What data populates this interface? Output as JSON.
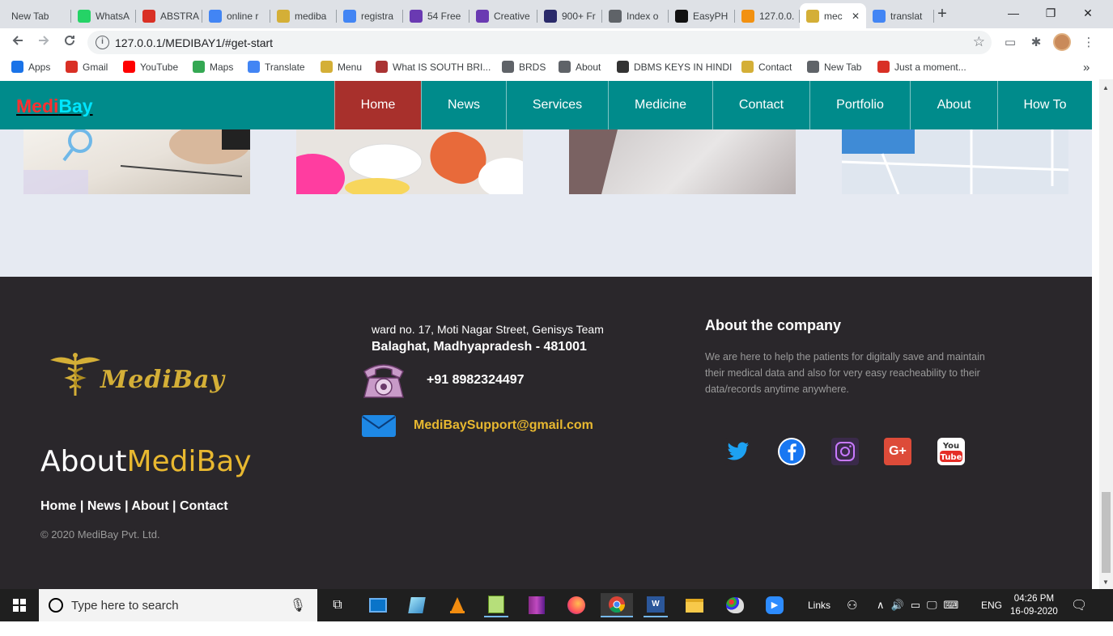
{
  "browser": {
    "tabs": [
      {
        "label": "New Tab",
        "icon": "blank-icon",
        "color": "#dee1e6"
      },
      {
        "label": "WhatsA",
        "icon": "whatsapp-icon",
        "color": "#25d366"
      },
      {
        "label": "ABSTRA",
        "icon": "gmail-icon",
        "color": "#d93025"
      },
      {
        "label": "online r",
        "icon": "google-icon",
        "color": "#4285f4"
      },
      {
        "label": "mediba",
        "icon": "caduceus-icon",
        "color": "#d4af37"
      },
      {
        "label": "registra",
        "icon": "google-icon",
        "color": "#4285f4"
      },
      {
        "label": "54 Free",
        "icon": "colorlib-icon",
        "color": "#6a3ab2"
      },
      {
        "label": "Creative",
        "icon": "colorlib-icon",
        "color": "#6a3ab2"
      },
      {
        "label": "900+ Fr",
        "icon": "w3-icon",
        "color": "#2a2a6a"
      },
      {
        "label": "Index o",
        "icon": "globe-icon",
        "color": "#5f6368"
      },
      {
        "label": "EasyPH",
        "icon": "easyphp-icon",
        "color": "#111111"
      },
      {
        "label": "127.0.0.",
        "icon": "pma-icon",
        "color": "#f29111"
      },
      {
        "label": "mec",
        "icon": "caduceus-icon",
        "color": "#d4af37"
      },
      {
        "label": "translat",
        "icon": "google-icon",
        "color": "#4285f4"
      }
    ],
    "close_glyph": "✕",
    "new_tab_glyph": "+",
    "window_controls": [
      "—",
      "❐",
      "✕"
    ],
    "url": "127.0.0.1/MEDIBAY1/#get-start",
    "bookmarks": [
      {
        "label": "Apps",
        "icon": "apps-grid-icon",
        "color": "#1a73e8"
      },
      {
        "label": "Gmail",
        "icon": "gmail-icon",
        "color": "#d93025"
      },
      {
        "label": "YouTube",
        "icon": "youtube-icon",
        "color": "#ff0000"
      },
      {
        "label": "Maps",
        "icon": "maps-icon",
        "color": "#34a853"
      },
      {
        "label": "Translate",
        "icon": "translate-icon",
        "color": "#4285f4"
      },
      {
        "label": "Menu",
        "icon": "caduceus-icon",
        "color": "#d4af37"
      },
      {
        "label": "What IS SOUTH BRI...",
        "icon": "image-icon",
        "color": "#a33"
      },
      {
        "label": "BRDS",
        "icon": "globe-icon",
        "color": "#5f6368"
      },
      {
        "label": "About",
        "icon": "globe-icon",
        "color": "#5f6368"
      },
      {
        "label": "DBMS KEYS IN HINDI",
        "icon": "eye-icon",
        "color": "#333"
      },
      {
        "label": "Contact",
        "icon": "caduceus-icon",
        "color": "#d4af37"
      },
      {
        "label": "New Tab",
        "icon": "globe-icon",
        "color": "#5f6368"
      },
      {
        "label": "Just a moment...",
        "icon": "cloud-icon",
        "color": "#d93025"
      }
    ],
    "bookmarks_more": "»"
  },
  "site": {
    "logo": {
      "part1": "Medi",
      "part2": "Bay"
    },
    "nav": [
      "Home",
      "News",
      "Services",
      "Medicine",
      "Contact",
      "Portfolio",
      "About",
      "How To"
    ],
    "active_nav": "Home",
    "footer": {
      "brand_script": "MediBay",
      "about_white": "About",
      "about_gold": "MediBay",
      "links": [
        "Home",
        "News",
        "About",
        "Contact"
      ],
      "link_sep": " | ",
      "copyright": "© 2020 MediBay Pvt. Ltd.",
      "address_line1": "ward no. 17, Moti Nagar Street, Genisys Team",
      "address_line2": "Balaghat, Madhyapradesh - 481001",
      "phone": "+91 8982324497",
      "email": "MediBaySupport@gmail.com",
      "company_title": "About the company",
      "company_text": "We are here to help the patients for digitally save and maintain their medical data and also for very easy reacheability to their data/records anytime anywhere.",
      "socials": [
        {
          "name": "twitter-icon",
          "color": "#1da1f2"
        },
        {
          "name": "facebook-icon",
          "color": "#1877f2"
        },
        {
          "name": "instagram-icon",
          "color": "#c13584"
        },
        {
          "name": "google-plus-icon",
          "color": "#dd4b39"
        },
        {
          "name": "youtube-icon",
          "color": "#ff0000"
        }
      ]
    }
  },
  "taskbar": {
    "search_placeholder": "Type here to search",
    "links_label": "Links",
    "lang": "ENG",
    "time": "04:26 PM",
    "date": "16-09-2020"
  }
}
